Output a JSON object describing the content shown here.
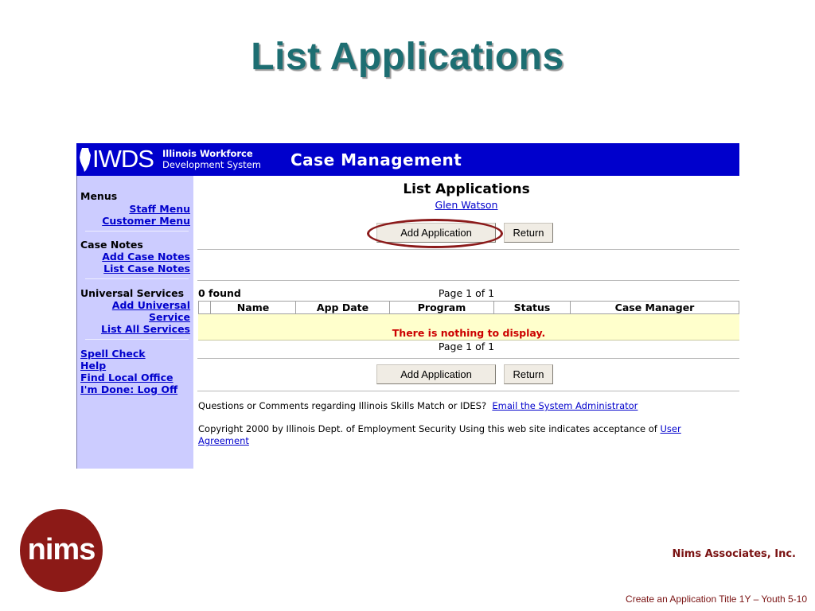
{
  "slide": {
    "title": "List Applications",
    "company": "Nims Associates, Inc.",
    "footer": "Create an Application Title 1Y – Youth  5-10",
    "logo_text": "nims"
  },
  "banner": {
    "logo": "IWDS",
    "system_line1": "Illinois Workforce",
    "system_line2": "Development System",
    "module": "Case Management"
  },
  "sidebar": {
    "menus_heading": "Menus",
    "staff_menu": "Staff Menu",
    "customer_menu": "Customer Menu",
    "case_notes_heading": "Case Notes",
    "add_case_notes": "Add Case Notes",
    "list_case_notes": "List Case Notes",
    "universal_heading": "Universal Services",
    "add_universal_1": "Add Universal",
    "add_universal_2": "Service",
    "list_all_services": "List All Services",
    "spell_check": "Spell Check",
    "help": "Help",
    "find_local_office": "Find Local Office",
    "log_off": "I'm Done: Log Off"
  },
  "main": {
    "title": "List Applications",
    "person": "Glen Watson",
    "add_application": "Add Application",
    "return": "Return",
    "found": "0  found",
    "page_info": "Page 1 of 1",
    "columns": [
      "Name",
      "App Date",
      "Program",
      "Status",
      "Case Manager"
    ],
    "empty_message": "There is nothing to display.",
    "questions_text": "Questions or Comments regarding Illinois Skills Match or IDES?",
    "email_admin": "Email the System Administrator",
    "copyright_text": "Copyright 2000 by Illinois Dept. of Employment Security Using this web site indicates acceptance of",
    "user_agreement": "User Agreement"
  },
  "colors": {
    "title_teal": "#1d6e72",
    "banner_blue": "#0000cc",
    "sidebar_lavender": "#ccccff",
    "empty_row_yellow": "#ffffcc",
    "error_red": "#cc0000",
    "brand_maroon": "#8c1a17"
  }
}
